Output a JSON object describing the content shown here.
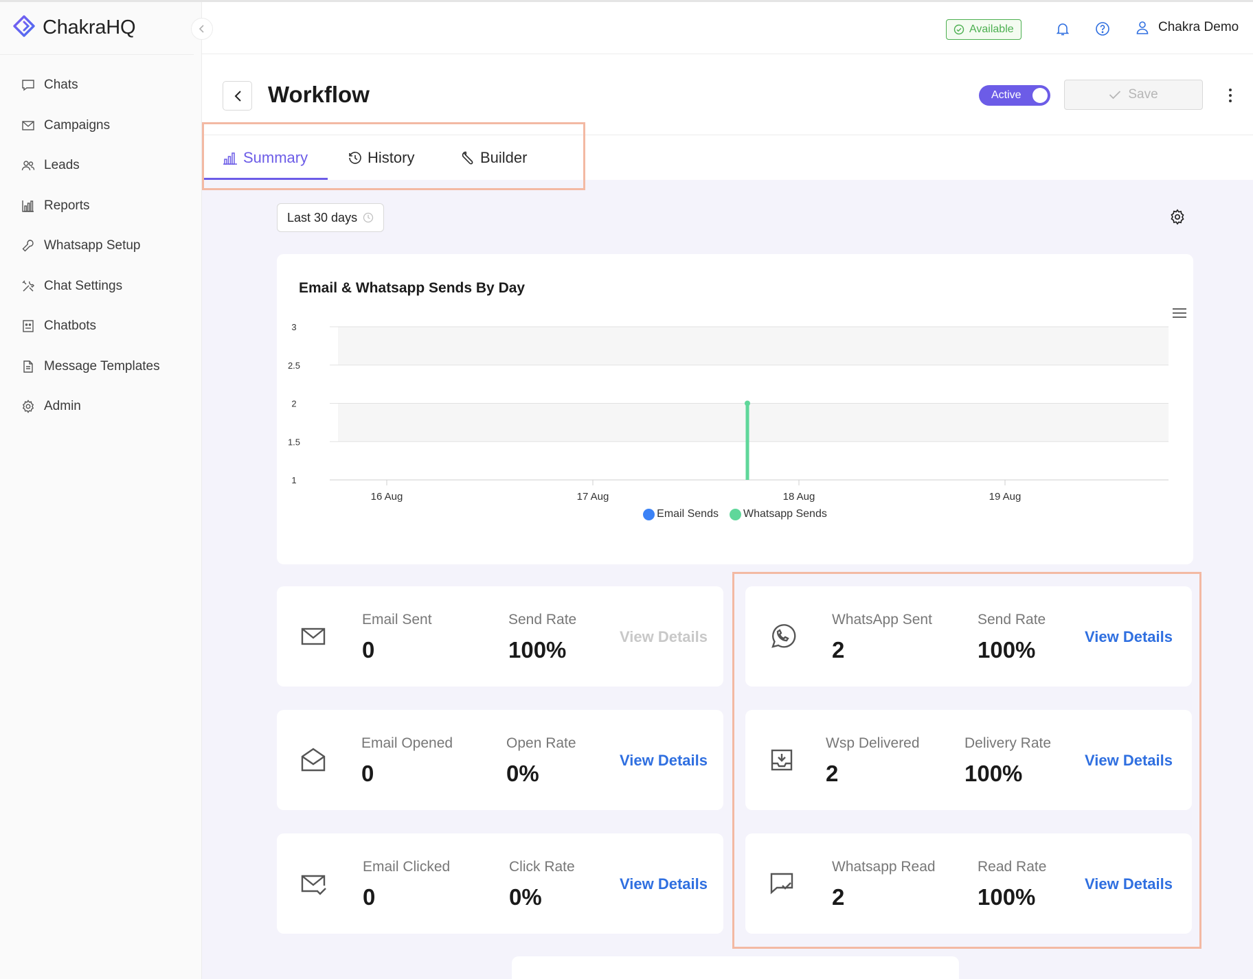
{
  "app": {
    "name": "ChakraHQ"
  },
  "sidebar": {
    "items": [
      {
        "label": "Chats",
        "icon": "chat-icon"
      },
      {
        "label": "Campaigns",
        "icon": "mail-icon"
      },
      {
        "label": "Leads",
        "icon": "users-icon"
      },
      {
        "label": "Reports",
        "icon": "bar-chart-icon"
      },
      {
        "label": "Whatsapp Setup",
        "icon": "wrench-icon"
      },
      {
        "label": "Chat Settings",
        "icon": "tools-icon"
      },
      {
        "label": "Chatbots",
        "icon": "bot-icon"
      },
      {
        "label": "Message Templates",
        "icon": "document-icon"
      },
      {
        "label": "Admin",
        "icon": "gear-icon"
      }
    ]
  },
  "topbar": {
    "status": "Available",
    "user_name": "Chakra Demo"
  },
  "header": {
    "title": "Workflow",
    "toggle_label": "Active",
    "toggle_on": true,
    "save_label": "Save"
  },
  "tabs": [
    {
      "label": "Summary",
      "icon": "bar-chart-icon",
      "active": true
    },
    {
      "label": "History",
      "icon": "history-icon",
      "active": false
    },
    {
      "label": "Builder",
      "icon": "wrench-icon",
      "active": false
    }
  ],
  "filters": {
    "date_range": "Last 30 days"
  },
  "chart_data": {
    "type": "bar",
    "title": "Email & Whatsapp Sends By Day",
    "xlabel": "",
    "ylabel": "",
    "categories": [
      "16 Aug",
      "17 Aug",
      "18 Aug",
      "19 Aug"
    ],
    "x_ticks": [
      "16 Aug",
      "17 Aug",
      "18 Aug",
      "19 Aug"
    ],
    "y_ticks": [
      "1",
      "1.5",
      "2",
      "2.5",
      "3"
    ],
    "ylim": [
      1,
      3
    ],
    "grid": true,
    "legend_position": "bottom",
    "series": [
      {
        "name": "Email Sends",
        "color": "#3b82f6",
        "points": []
      },
      {
        "name": "Whatsapp Sends",
        "color": "#5fd79a",
        "points": [
          {
            "x": "17 Aug 18:00",
            "y": 2
          }
        ]
      }
    ]
  },
  "stats": {
    "email_sent": {
      "label": "Email Sent",
      "value": "0",
      "rate_label": "Send Rate",
      "rate": "100%",
      "link": "View Details"
    },
    "email_opened": {
      "label": "Email Opened",
      "value": "0",
      "rate_label": "Open Rate",
      "rate": "0%",
      "link": "View Details"
    },
    "email_clicked": {
      "label": "Email Clicked",
      "value": "0",
      "rate_label": "Click Rate",
      "rate": "0%",
      "link": "View Details"
    },
    "whatsapp_sent": {
      "label": "WhatsApp Sent",
      "value": "2",
      "rate_label": "Send Rate",
      "rate": "100%",
      "link": "View Details"
    },
    "wsp_delivered": {
      "label": "Wsp Delivered",
      "value": "2",
      "rate_label": "Delivery Rate",
      "rate": "100%",
      "link": "View Details"
    },
    "whatsapp_read": {
      "label": "Whatsapp Read",
      "value": "2",
      "rate_label": "Read Rate",
      "rate": "100%",
      "link": "View Details"
    }
  },
  "colors": {
    "accent": "#6c5ce7",
    "link": "#2f6fe0",
    "available": "#4caf50",
    "highlight": "#f3b9a3"
  }
}
